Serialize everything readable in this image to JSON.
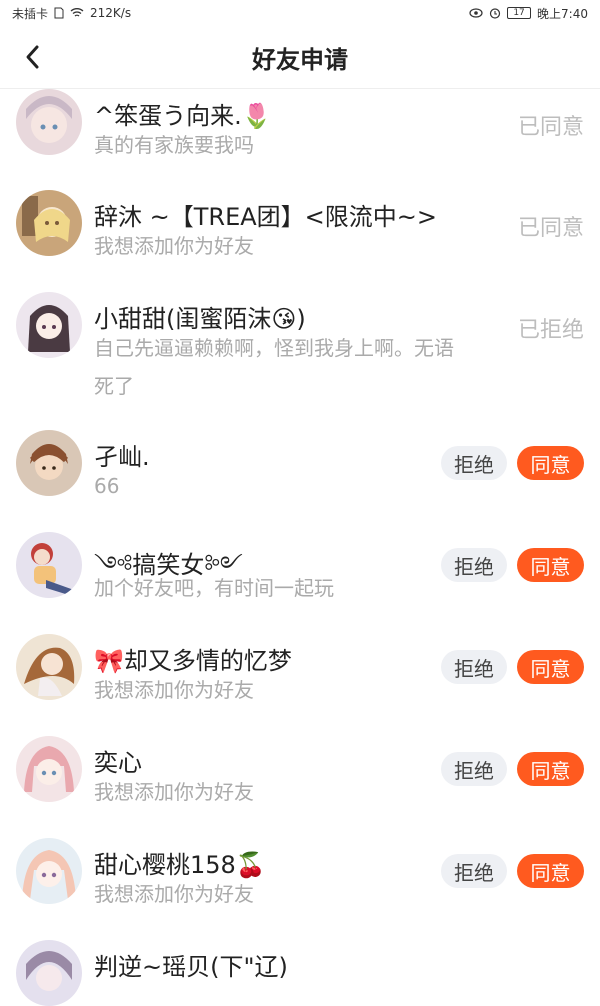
{
  "status_bar": {
    "carrier": "未插卡",
    "speed": "212K/s",
    "battery": "17",
    "time": "晚上7:40"
  },
  "header": {
    "title": "好友申请"
  },
  "requests": [
    {
      "name": "^笨蛋う向来.🌷",
      "message": "真的有家族要我吗",
      "status": "已同意"
    },
    {
      "name": "辞沐 ~【TREA团】<限流中~>",
      "message": "我想添加你为好友",
      "status": "已同意"
    },
    {
      "name": "小甜甜(闺蜜陌沫😘)",
      "message_line1": "自己先逼逼赖赖啊，怪到我身上啊。无语",
      "message_line2": "死了",
      "status": "已拒绝"
    },
    {
      "name": "孑屾.",
      "message": "66",
      "reject_label": "拒绝",
      "accept_label": "同意"
    },
    {
      "name": "༺搞笑女༻",
      "message": "加个好友吧，有时间一起玩",
      "reject_label": "拒绝",
      "accept_label": "同意"
    },
    {
      "name": "🎀却又多情的忆梦",
      "message": "我想添加你为好友",
      "reject_label": "拒绝",
      "accept_label": "同意"
    },
    {
      "name": "奕心",
      "message": "我想添加你为好友",
      "reject_label": "拒绝",
      "accept_label": "同意"
    },
    {
      "name": "甜心樱桃158🍒",
      "message": "我想添加你为好友",
      "reject_label": "拒绝",
      "accept_label": "同意"
    },
    {
      "name": "判逆~瑶贝(下\"辽)"
    }
  ],
  "colors": {
    "accept": "#ff5a1f",
    "reject_bg": "#eef0f4",
    "secondary_text": "#aaaaaa",
    "status_text": "#bdbdbd"
  }
}
